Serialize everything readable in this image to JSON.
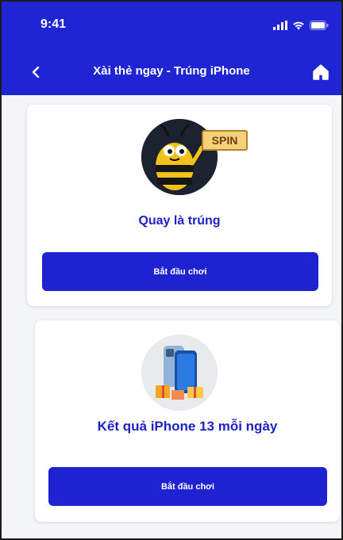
{
  "status_bar": {
    "time": "9:41"
  },
  "nav": {
    "title": "Xài thẻ ngay - Trúng iPhone",
    "back_icon": "chevron-left-icon",
    "home_icon": "home-icon"
  },
  "cards": [
    {
      "badge_text": "SPIN",
      "title": "Quay là trúng",
      "button_label": "Bắt đầu chơi"
    },
    {
      "title": "Kết quả iPhone 13 mỗi ngày",
      "button_label": "Bắt đầu chơi"
    }
  ],
  "colors": {
    "brand_blue": "#1f25d3",
    "title_blue": "#1d22c6",
    "background": "#f4f5f7"
  }
}
